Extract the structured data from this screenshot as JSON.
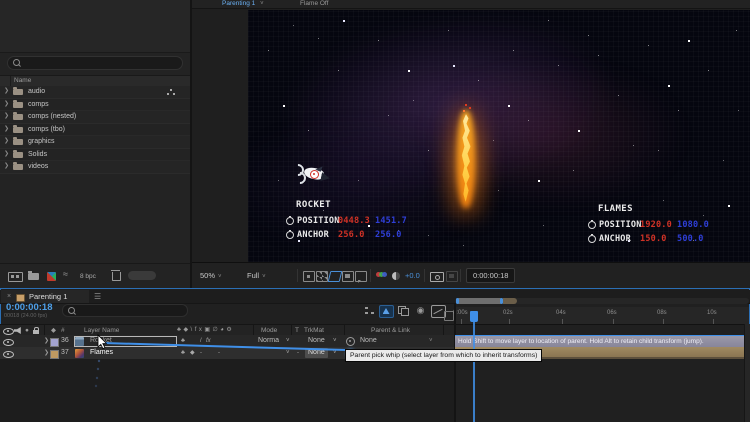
{
  "colors": {
    "accent_blue": "#3f8fe8",
    "value_red": "#d03226",
    "value_blue": "#2f3fd8"
  },
  "project": {
    "name_header": "Name",
    "bit_depth": "8 bpc",
    "folders": [
      {
        "label": "audio"
      },
      {
        "label": "comps"
      },
      {
        "label": "comps (nested)"
      },
      {
        "label": "comps (tbo)"
      },
      {
        "label": "graphics"
      },
      {
        "label": "Solids"
      },
      {
        "label": "videos"
      }
    ]
  },
  "viewer": {
    "tab_active": "Parenting 1",
    "tab_inactive": "Flame Off",
    "zoom": "50%",
    "resolution": "Full",
    "exposure": "+0.0",
    "timecode": "0:00:00:18",
    "overlay": {
      "rocket": {
        "title": "ROCKET",
        "position_label": "POSITION",
        "position_x": "0448.3",
        "position_y": "1451.7",
        "anchor_label": "ANCHOR",
        "anchor_x": "256.0",
        "anchor_y": "256.0"
      },
      "flames": {
        "title": "FLAMES",
        "position_label": "POSITION",
        "position_x": "1920.0",
        "position_y": "1080.0",
        "anchor_label": "ANCHOR",
        "anchor_x": "150.0",
        "anchor_y": "500.0"
      }
    }
  },
  "timeline": {
    "tab": "Parenting 1",
    "timecode": "0:00:00:18",
    "frame_info": "00018 (24.00 fps)",
    "headers": {
      "index": "#",
      "layer_name": "Layer Name",
      "mode": "Mode",
      "t": "T",
      "trkmat": "TrkMat",
      "parent_link": "Parent & Link"
    },
    "ruler": [
      "0:00s",
      "02s",
      "04s",
      "06s",
      "08s",
      "10s"
    ],
    "layers": [
      {
        "index": "36",
        "name": "Rocket",
        "mode": "Norma",
        "trkmat": "None",
        "parent": "None"
      },
      {
        "index": "37",
        "name": "Flames",
        "trkmat": "None",
        "parent": "None"
      }
    ],
    "hint_bar": "Hold Shift to move layer to location of parent. Hold Alt to retain child transform (jump).",
    "tooltip": "Parent pick whip (select layer from which to inherit transforms)"
  }
}
